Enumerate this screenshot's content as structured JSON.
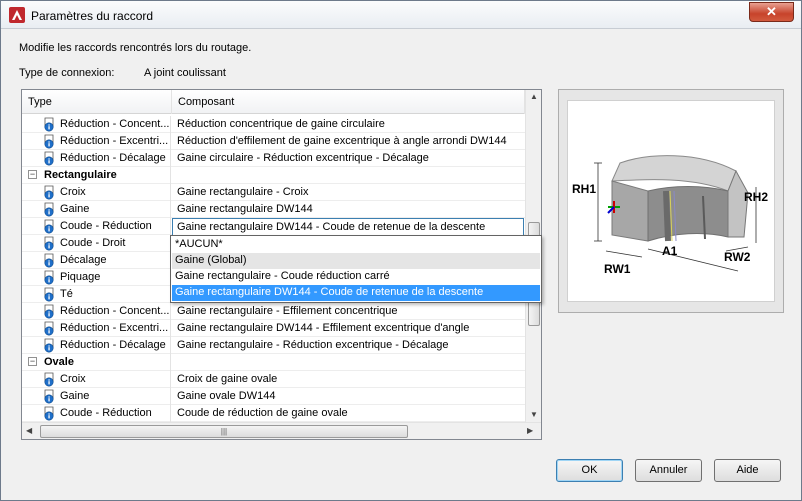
{
  "window": {
    "title": "Paramètres du raccord",
    "close_glyph": "✕"
  },
  "description": "Modifie les raccords rencontrés lors du routage.",
  "connection": {
    "label": "Type de connexion:",
    "value": "A joint coulissant"
  },
  "grid": {
    "headers": {
      "type": "Type",
      "component": "Composant"
    },
    "rows": [
      {
        "kind": "item",
        "type": "Réduction - Concent...",
        "component": "Réduction concentrique de gaine circulaire"
      },
      {
        "kind": "item",
        "type": "Réduction - Excentri...",
        "component": "Réduction d'effilement de gaine excentrique à angle arrondi DW144"
      },
      {
        "kind": "item",
        "type": "Réduction - Décalage",
        "component": "Gaine circulaire - Réduction excentrique - Décalage"
      },
      {
        "kind": "group",
        "type": "Rectangulaire",
        "toggle": "−"
      },
      {
        "kind": "item",
        "type": "Croix",
        "component": "Gaine rectangulaire - Croix"
      },
      {
        "kind": "item",
        "type": "Gaine",
        "component": "Gaine rectangulaire DW144"
      },
      {
        "kind": "item",
        "type": "Coude - Réduction",
        "component": "Gaine rectangulaire DW144 - Coude de retenue de la descente",
        "editing": true
      },
      {
        "kind": "item",
        "type": "Coude - Droit",
        "component": ""
      },
      {
        "kind": "item",
        "type": "Décalage",
        "component": ""
      },
      {
        "kind": "item",
        "type": "Piquage",
        "component": ""
      },
      {
        "kind": "item",
        "type": "Té",
        "component": ""
      },
      {
        "kind": "item",
        "type": "Réduction - Concent...",
        "component": "Gaine rectangulaire - Effilement concentrique"
      },
      {
        "kind": "item",
        "type": "Réduction - Excentri...",
        "component": "Gaine rectangulaire DW144 - Effilement excentrique d'angle"
      },
      {
        "kind": "item",
        "type": "Réduction - Décalage",
        "component": "Gaine rectangulaire - Réduction excentrique - Décalage"
      },
      {
        "kind": "group",
        "type": "Ovale",
        "toggle": "−"
      },
      {
        "kind": "item",
        "type": "Croix",
        "component": "Croix de gaine ovale"
      },
      {
        "kind": "item",
        "type": "Gaine",
        "component": "Gaine ovale DW144"
      },
      {
        "kind": "item",
        "type": "Coude - Réduction",
        "component": "Coude de réduction de gaine ovale"
      }
    ],
    "hscroll_grip": "|||"
  },
  "dropdown": {
    "options": [
      "*AUCUN*",
      "Gaine (Global)",
      "Gaine rectangulaire - Coude réduction carré",
      "Gaine rectangulaire DW144 - Coude de retenue de la descente"
    ],
    "hovered_index": 1,
    "selected_index": 3
  },
  "preview": {
    "labels": {
      "rh1": "RH1",
      "rh2": "RH2",
      "rw1": "RW1",
      "rw2": "RW2",
      "a1": "A1"
    }
  },
  "buttons": {
    "ok": "OK",
    "cancel": "Annuler",
    "help": "Aide"
  }
}
